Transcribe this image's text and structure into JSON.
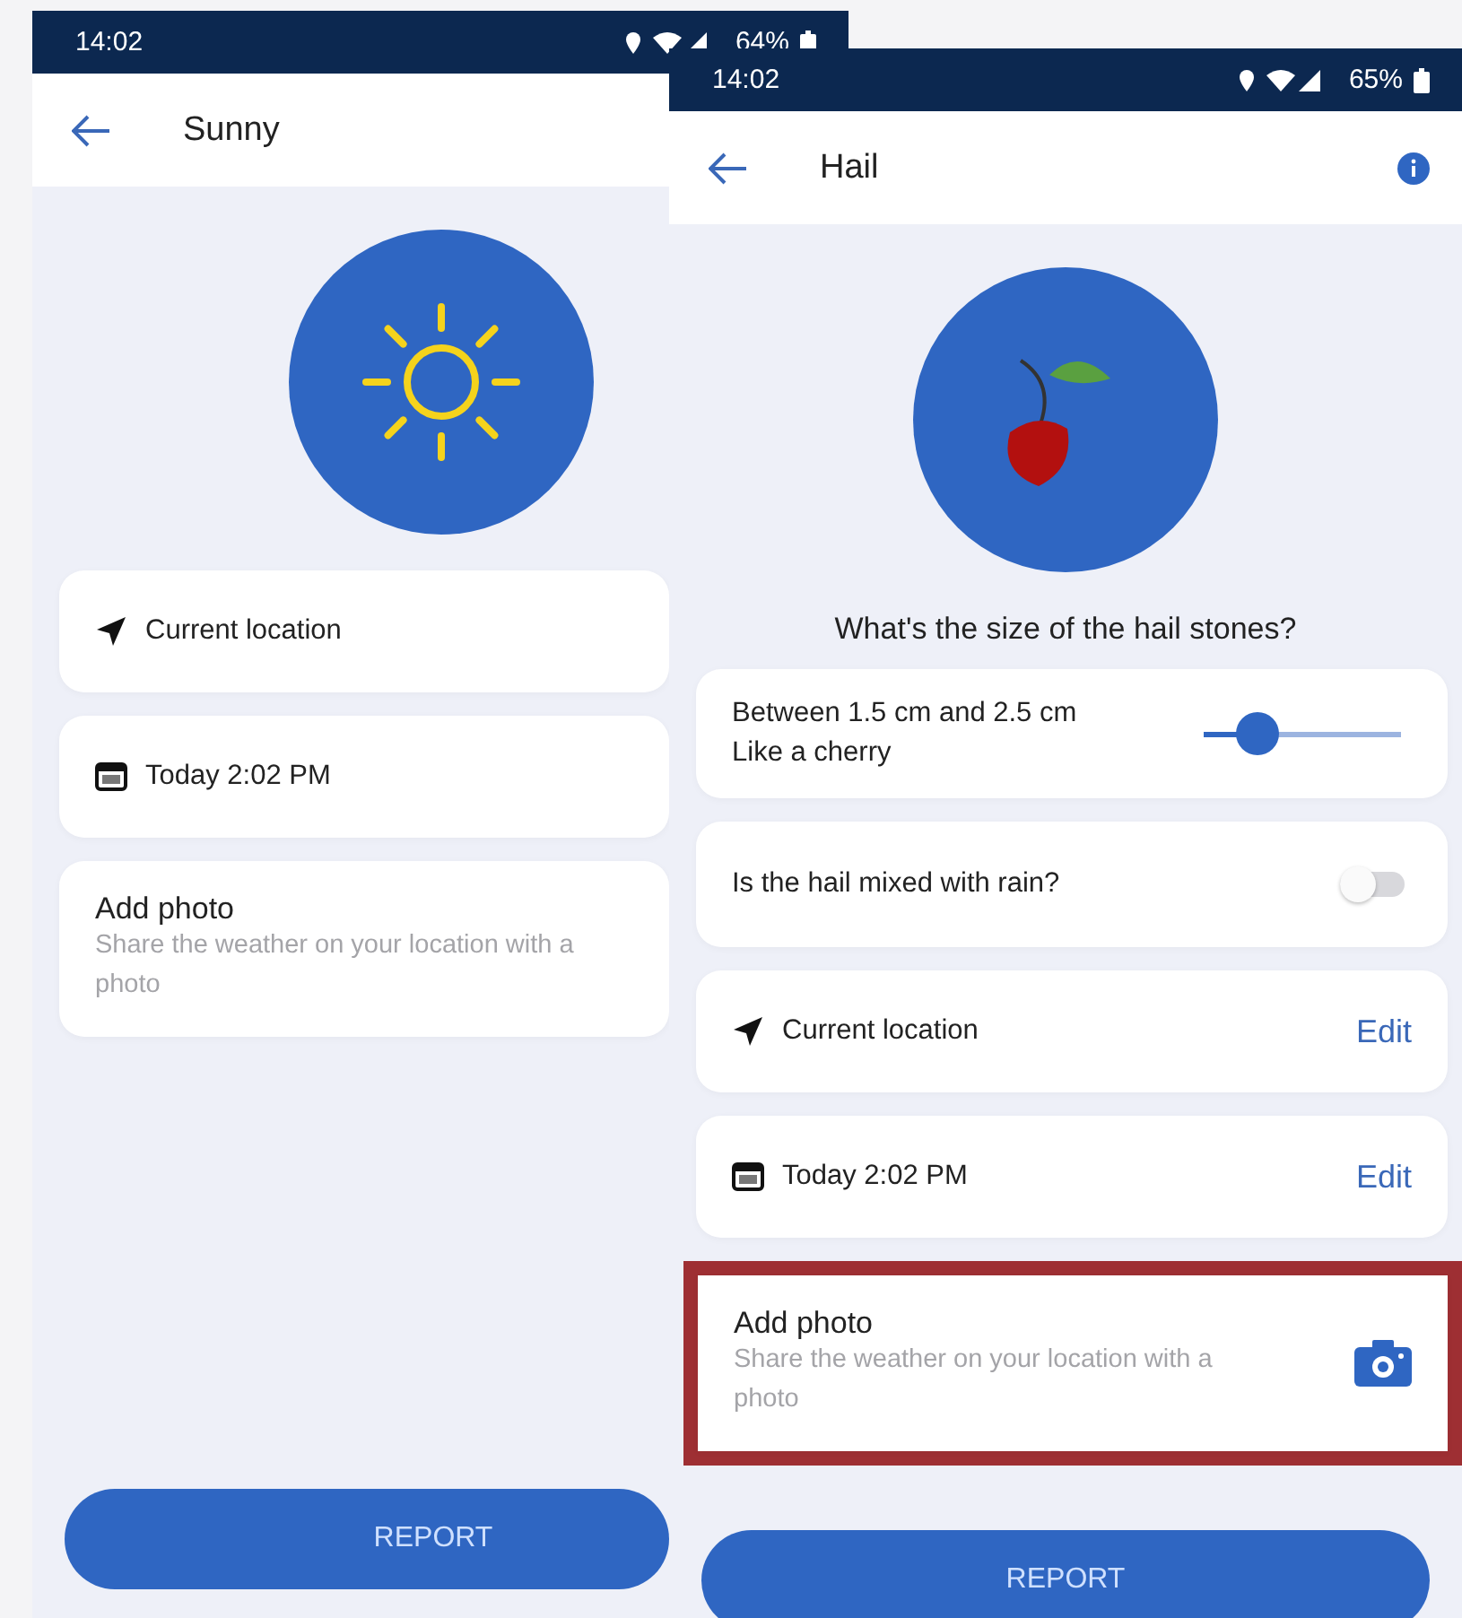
{
  "screens": [
    {
      "kind": "sunny",
      "status": {
        "time": "14:02",
        "battery": "64%"
      },
      "title": "Sunny",
      "items": [
        {
          "kind": "location",
          "label": "Current location"
        },
        {
          "kind": "datetime",
          "label": "Today 2:02 PM"
        },
        {
          "kind": "photo",
          "label": "Add photo",
          "description": "Share the weather on your location with a photo",
          "highlighted": false
        }
      ],
      "report": "REPORT"
    },
    {
      "kind": "hail",
      "status": {
        "time": "14:02",
        "battery": "65%"
      },
      "title": "Hail",
      "info": true,
      "question": "What's the size of the hail stones?",
      "items": [
        {
          "kind": "slider",
          "label": "Between 1.5 cm and 2.5 cm",
          "sublabel": "Like a cherry",
          "level": 0.27
        },
        {
          "kind": "toggle",
          "label": "Is the hail mixed with rain?",
          "on": false
        },
        {
          "kind": "location",
          "label": "Current location",
          "action": "Edit"
        },
        {
          "kind": "datetime",
          "label": "Today 2:02 PM",
          "action": "Edit"
        },
        {
          "kind": "photo",
          "label": "Add photo",
          "description": "Share the weather on your location with a photo",
          "highlighted": true
        }
      ],
      "report": "REPORT"
    }
  ]
}
